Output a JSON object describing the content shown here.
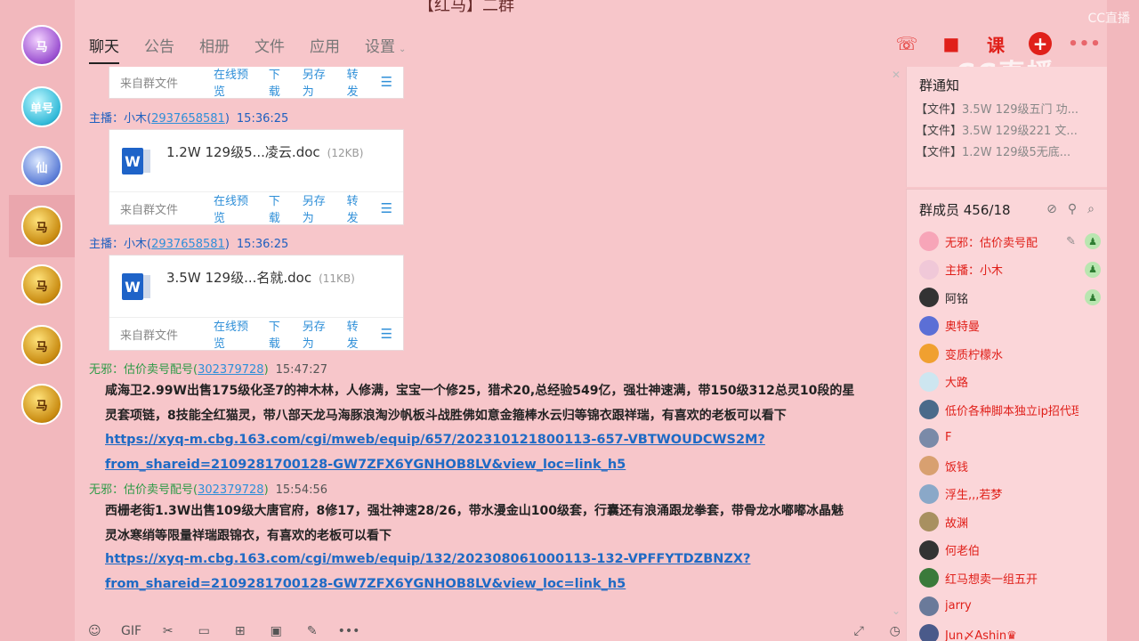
{
  "window": {
    "title": "【红马】二群"
  },
  "watermark": {
    "corner": "CC直播",
    "big": "CC直播"
  },
  "rail": {
    "avatars": [
      {
        "label": "马",
        "style": "purple"
      },
      {
        "label": "单号",
        "style": "cyan"
      },
      {
        "label": "仙",
        "style": "blue"
      },
      {
        "label": "马",
        "style": "gold"
      },
      {
        "label": "马",
        "style": "gold"
      },
      {
        "label": "马",
        "style": "gold"
      },
      {
        "label": "马",
        "style": "gold"
      }
    ]
  },
  "tabs": [
    "聊天",
    "公告",
    "相册",
    "文件",
    "应用",
    "设置"
  ],
  "toolbar": {
    "call": "☏",
    "video": "■",
    "class": "课",
    "add": "+",
    "more": "•••"
  },
  "file_card_actions": {
    "source": "来自群文件",
    "preview": "在线预览",
    "download": "下载",
    "save_as": "另存为",
    "forward": "转发",
    "menu": "☰"
  },
  "messages": [
    {
      "sender_role": "主播：",
      "sender_name": "小木",
      "qq": "2937658581",
      "time": "15:36:25",
      "file_name": "1.2W   129级5...凌云.doc",
      "file_size": "(12KB)"
    },
    {
      "sender_role": "主播：",
      "sender_name": "小木",
      "qq": "2937658581",
      "time": "15:36:25",
      "file_name": "3.5W    129级...名就.doc",
      "file_size": "(11KB)"
    },
    {
      "sender_role": "无邪：",
      "sender_name": "估价卖号配号",
      "qq": "302379728",
      "time": "15:47:27",
      "text_lines": [
        "咸海卫2.99W出售175级化圣7的神木林，人修满，宝宝一个修25，猎术20,总经验549亿，强壮神速满，带150级312总灵10段的星",
        "灵套项链，8技能全红猫灵，带八部天龙马海豚浪淘沙帆板斗战胜佛如意金箍棒水云归等锦衣跟祥瑞，有喜欢的老板可以看下"
      ],
      "link_lines": [
        "https://xyq-m.cbg.163.com/cgi/mweb/equip/657/202310121800113-657-VBTWOUDCWS2M?",
        "from_shareid=2109281700128-GW7ZFX6YGNHOB8LV&view_loc=link_h5"
      ]
    },
    {
      "sender_role": "无邪：",
      "sender_name": "估价卖号配号",
      "qq": "302379728",
      "time": "15:54:56",
      "text_lines": [
        "西栅老街1.3W出售109级大唐官府，8修17，强壮神速28/26，带水漫金山100级套，行囊还有浪涌跟龙拳套，带骨龙水嘟嘟冰晶魅",
        "灵冰寒绡等限量祥瑞跟锦衣，有喜欢的老板可以看下"
      ],
      "link_lines": [
        "https://xyq-m.cbg.163.com/cgi/mweb/equip/132/202308061000113-132-VPFFYTDZBNZX?",
        "from_shareid=2109281700128-GW7ZFX6YGNHOB8LV&view_loc=link_h5"
      ]
    }
  ],
  "bottombar": [
    "☺",
    "GIF",
    "✂",
    "▭",
    "⊞",
    "▣",
    "✎",
    "•••",
    "⤢",
    "◷"
  ],
  "notice": {
    "title": "群通知",
    "items": [
      {
        "tag": "【文件】",
        "text": "3.5W    129级五门   功..."
      },
      {
        "tag": "【文件】",
        "text": "3.5W    129级221   文..."
      },
      {
        "tag": "【文件】",
        "text": "1.2W    129级5无底..."
      }
    ]
  },
  "members": {
    "title": "群成员 456/18",
    "list": [
      {
        "name": "无邪：估价卖号配",
        "red": true,
        "color": "#f7a5b8",
        "badge": true,
        "pen": true
      },
      {
        "name": "主播：小木",
        "red": true,
        "color": "#f0c8d8",
        "badge": true
      },
      {
        "name": "阿铭",
        "red": false,
        "color": "#333333",
        "badge": true
      },
      {
        "name": "奥特曼",
        "red": true,
        "color": "#5b6fd6"
      },
      {
        "name": "变质柠檬水",
        "red": true,
        "color": "#f0a030"
      },
      {
        "name": "大路",
        "red": true,
        "color": "#cde6f0"
      },
      {
        "name": "低价各种脚本独立ip招代理",
        "red": true,
        "color": "#4a6a8a"
      },
      {
        "name": "F",
        "red": true,
        "color": "#7a8aa8"
      },
      {
        "name": "饭钱",
        "red": true,
        "color": "#d8a070"
      },
      {
        "name": "浮生,,,若梦",
        "red": true,
        "color": "#8aa8c8"
      },
      {
        "name": "故渊",
        "red": true,
        "color": "#a89060"
      },
      {
        "name": "何老伯",
        "red": true,
        "color": "#333333"
      },
      {
        "name": "红马想卖一组五开",
        "red": true,
        "color": "#3a7a3a"
      },
      {
        "name": "jarry",
        "red": true,
        "color": "#6a7a9a"
      },
      {
        "name": "Jun〆Ashin♛",
        "red": true,
        "color": "#4a5a8a"
      }
    ]
  }
}
